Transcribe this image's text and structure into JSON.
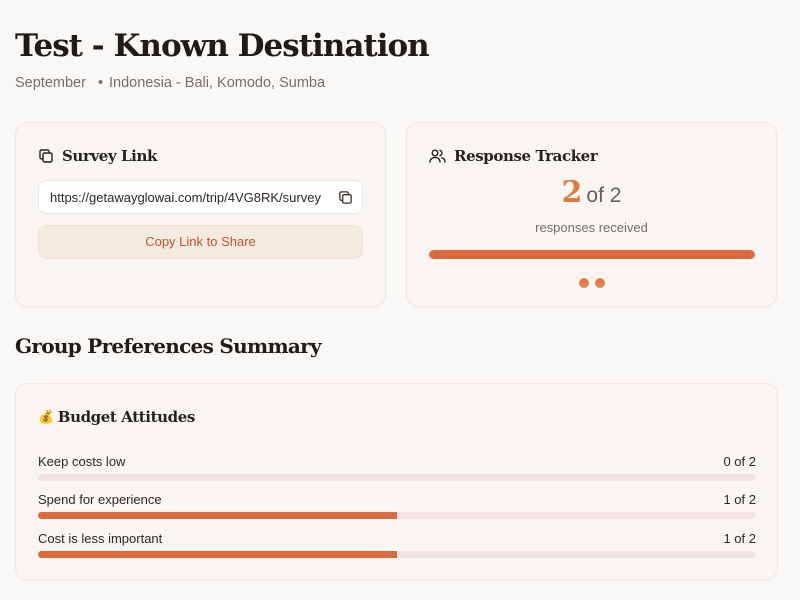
{
  "header": {
    "title": "Test - Known Destination",
    "month": "September",
    "bullet": "•",
    "destination": "Indonesia - Bali, Komodo, Sumba"
  },
  "survey": {
    "heading": "Survey Link",
    "heading_icon": "copy-icon",
    "url": "https://getawayglowai.com/trip/4VG8RK/survey",
    "copy_icon": "copy-icon",
    "copy_button_label": "Copy Link to Share"
  },
  "tracker": {
    "heading": "Response Tracker",
    "heading_icon": "users-icon",
    "received": "2",
    "of_total": "of 2",
    "received_count": 2,
    "total_count": 2,
    "subtitle": "responses received",
    "progress_fraction": 1.0,
    "accent_color": "#dd6a3f",
    "dot_color": "#e0823f"
  },
  "summary": {
    "heading": "Group Preferences Summary",
    "budget": {
      "emoji": "💰",
      "heading": "Budget Attitudes",
      "items": [
        {
          "label": "Keep costs low",
          "count": "0 of 2",
          "fraction": 0.0
        },
        {
          "label": "Spend for experience",
          "count": "1 of 2",
          "fraction": 0.5
        },
        {
          "label": "Cost is less important",
          "count": "1 of 2",
          "fraction": 0.5
        }
      ]
    }
  }
}
